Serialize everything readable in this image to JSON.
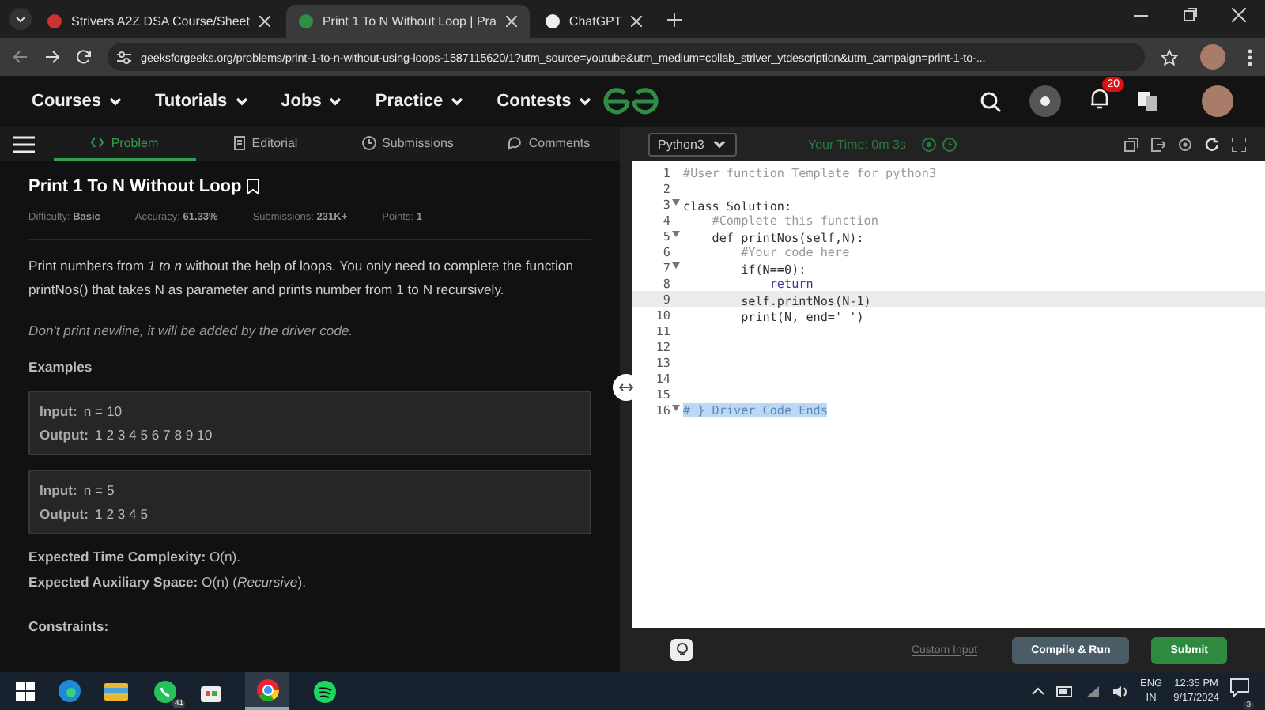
{
  "browser_tabs": [
    {
      "title": "Strivers A2Z DSA Course/Sheet",
      "selected": false
    },
    {
      "title": "Print 1 To N Without Loop | Pra",
      "selected": true
    },
    {
      "title": "ChatGPT",
      "selected": false
    }
  ],
  "address": "geeksforgeeks.org/problems/print-1-to-n-without-using-loops-1587115620/1?utm_source=youtube&utm_medium=collab_striver_ytdescription&utm_campaign=print-1-to-...",
  "nav": {
    "items": [
      "Courses",
      "Tutorials",
      "Jobs",
      "Practice",
      "Contests"
    ],
    "notification_count": "20"
  },
  "problem_tabs": [
    {
      "label": "Problem",
      "selected": true,
      "kind": "code"
    },
    {
      "label": "Editorial",
      "selected": false,
      "kind": "doc"
    },
    {
      "label": "Submissions",
      "selected": false,
      "kind": "clock"
    },
    {
      "label": "Comments",
      "selected": false,
      "kind": "chat"
    }
  ],
  "problem": {
    "title": "Print 1 To N Without Loop",
    "meta": [
      {
        "label": "Difficulty:",
        "value": "Basic"
      },
      {
        "label": "Accuracy:",
        "value": "61.33%"
      },
      {
        "label": "Submissions:",
        "value": "231K+"
      },
      {
        "label": "Points:",
        "value": "1"
      }
    ],
    "description": "Print numbers from *1 to n* without the help of loops. You only need to complete the function printNos() that takes N as parameter and prints number from 1 to N recursively.",
    "note": "Don't print newline, it will be added by the driver code.",
    "examples_heading": "Examples",
    "examples": [
      {
        "input_label": "Input:",
        "input": "n = 10",
        "output_label": "Output:",
        "output": "1 2 3 4 5 6 7 8 9 10"
      },
      {
        "input_label": "Input:",
        "input": "n = 5",
        "output_label": "Output:",
        "output": "1 2 3 4 5"
      }
    ],
    "complexity": [
      "**Expected Time Complexity:** O(n).",
      "**Expected Auxiliary Space:** O(n) (*Recursive*)."
    ],
    "constraints_heading": "Constraints:"
  },
  "editor": {
    "language": "Python3",
    "timer": "Your Time: 0m 3s",
    "lines": [
      {
        "number": "1",
        "text": "#User function Template for python3",
        "kind": "comment",
        "foldable": false,
        "selected": false,
        "highlighted": false
      },
      {
        "number": "2",
        "foldable": false,
        "selected": false,
        "highlighted": false
      },
      {
        "number": "3",
        "text": "class Solution:",
        "kind": "code",
        "foldable": true,
        "selected": false,
        "highlighted": false
      },
      {
        "number": "4",
        "text": "    #Complete this function",
        "kind": "comment",
        "foldable": false,
        "selected": false,
        "highlighted": false
      },
      {
        "number": "5",
        "text": "    def printNos(self,N):",
        "kind": "code",
        "foldable": true,
        "selected": false,
        "highlighted": false
      },
      {
        "number": "6",
        "text": "        #Your code here",
        "kind": "comment",
        "foldable": false,
        "selected": false,
        "highlighted": false
      },
      {
        "number": "7",
        "text": "        if(N==0):",
        "kind": "code",
        "foldable": true,
        "selected": false,
        "highlighted": false
      },
      {
        "number": "8",
        "text": "            return",
        "kind": "keyword",
        "foldable": false,
        "selected": false,
        "highlighted": false
      },
      {
        "number": "9",
        "text": "        self.printNos(N-1)",
        "kind": "code",
        "foldable": false,
        "selected": true,
        "highlighted": false
      },
      {
        "number": "10",
        "text": "        print(N, end=' ')",
        "kind": "code",
        "foldable": false,
        "selected": false,
        "highlighted": false
      },
      {
        "number": "11",
        "foldable": false,
        "selected": false,
        "highlighted": false
      },
      {
        "number": "12",
        "foldable": false,
        "selected": false,
        "highlighted": false
      },
      {
        "number": "13",
        "foldable": false,
        "selected": false,
        "highlighted": false
      },
      {
        "number": "14",
        "foldable": false,
        "selected": false,
        "highlighted": false
      },
      {
        "number": "15",
        "foldable": false,
        "selected": false,
        "highlighted": false
      },
      {
        "number": "16",
        "text": "# } Driver Code Ends",
        "kind": "comment",
        "foldable": true,
        "selected": false,
        "highlighted": true
      }
    ],
    "custom_input": "Custom Input",
    "compile_button": "Compile & Run",
    "submit_button": "Submit"
  },
  "taskbar": {
    "whatsapp_badge": "41",
    "language": "ENG",
    "region": "IN",
    "time": "12:35 PM",
    "date": "9/17/2024",
    "notification_count": "3"
  }
}
